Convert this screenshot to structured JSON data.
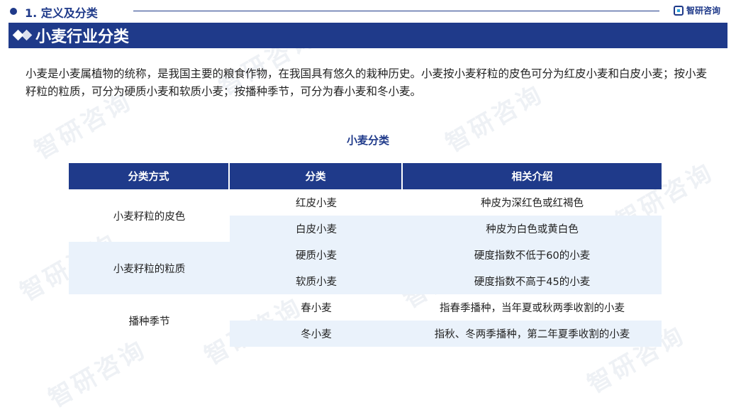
{
  "header": {
    "section_title": "1. 定义及分类",
    "brand_name": "智研咨询"
  },
  "watermark": {
    "text": "智研咨询"
  },
  "heading": {
    "title": "小麦行业分类"
  },
  "intro_text": "小麦是小麦属植物的统称，是我国主要的粮食作物，在我国具有悠久的栽种历史。小麦按小麦籽粒的皮色可分为红皮小麦和白皮小麦；按小麦籽粒的粒质，可分为硬质小麦和软质小麦；按播种季节，可分为春小麦和冬小麦。",
  "table": {
    "title": "小麦分类",
    "headers": [
      "分类方式",
      "分类",
      "相关介绍"
    ],
    "groups": [
      {
        "label": "小麦籽粒的皮色",
        "rows": [
          {
            "category": "红皮小麦",
            "description": "种皮为深红色或红褐色"
          },
          {
            "category": "白皮小麦",
            "description": "种皮为白色或黄白色"
          }
        ]
      },
      {
        "label": "小麦籽粒的粒质",
        "rows": [
          {
            "category": "硬质小麦",
            "description": "硬度指数不低于60的小麦"
          },
          {
            "category": "软质小麦",
            "description": "硬度指数不高于45的小麦"
          }
        ]
      },
      {
        "label": "播种季节",
        "rows": [
          {
            "category": "春小麦",
            "description": "指春季播种，当年夏或秋两季收割的小麦"
          },
          {
            "category": "冬小麦",
            "description": "指秋、冬两季播种，第二年夏季收割的小麦"
          }
        ]
      }
    ]
  },
  "colors": {
    "brand": "#1f3a8a",
    "row_shade": "#eaf2fb",
    "accent": "#2aa6de"
  }
}
